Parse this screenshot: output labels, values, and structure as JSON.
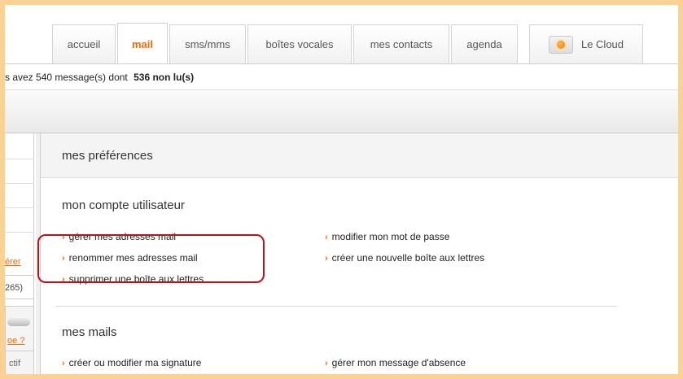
{
  "tabs": [
    {
      "label": "accueil"
    },
    {
      "label": "mail"
    },
    {
      "label": "sms/mms"
    },
    {
      "label": "boîtes vocales"
    },
    {
      "label": "mes contacts"
    },
    {
      "label": "agenda"
    },
    {
      "label": "Le Cloud"
    }
  ],
  "message_bar": {
    "prefix": "s avez 540 message(s) dont",
    "count": "536 non lu(s)"
  },
  "sidebar": {
    "link1": "érer",
    "value1": "265)",
    "link2": "oe ?",
    "label2": "ctif"
  },
  "panel": {
    "title": "mes préférences",
    "account_section": {
      "title": "mon compte utilisateur",
      "items": [
        "gérer mes adresses mail",
        "renommer mes adresses mail",
        "supprimer une boîte aux lettres",
        "modifier mon mot de passe",
        "créer une nouvelle boîte aux lettres"
      ]
    },
    "mail_section": {
      "title": "mes mails",
      "items": [
        "créer ou modifier ma signature",
        "gérer mon message d'absence"
      ]
    }
  },
  "colors": {
    "accent": "#ff6600",
    "highlight": "#b7131a",
    "frame": "#fdd190"
  }
}
